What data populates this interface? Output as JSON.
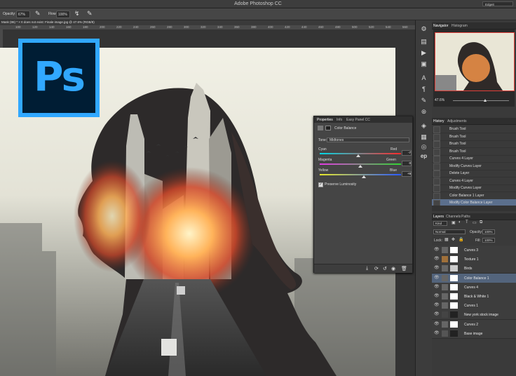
{
  "app": {
    "title": "Adobe Photoshop CC",
    "workspace": "Edgeit"
  },
  "options_bar": {
    "opacity_label": "Opacity:",
    "opacity_value": "67%",
    "flow_label": "Flow:",
    "flow_value": "100%"
  },
  "document_tab": {
    "title": "Mask (86) * ×   It does not exist: Finale image.jpg @ 47.6% (RGB/8)"
  },
  "ruler": {
    "ticks": [
      "100",
      "120",
      "140",
      "160",
      "180",
      "200",
      "220",
      "240",
      "260",
      "280",
      "300",
      "320",
      "340",
      "360",
      "380",
      "400",
      "420",
      "440",
      "460",
      "480",
      "500",
      "520",
      "540",
      "560"
    ]
  },
  "logo": {
    "text": "Ps"
  },
  "navigator": {
    "tabs": [
      "Navigator",
      "Histogram"
    ],
    "zoom": "47.6%"
  },
  "history": {
    "tabs": [
      "History",
      "Adjustments"
    ],
    "items": [
      {
        "label": "Brush Tool"
      },
      {
        "label": "Brush Tool"
      },
      {
        "label": "Brush Tool"
      },
      {
        "label": "Brush Tool"
      },
      {
        "label": "Curves 4 Layer"
      },
      {
        "label": "Modify Curves Layer"
      },
      {
        "label": "Delete Layer"
      },
      {
        "label": "Curves 4 Layer"
      },
      {
        "label": "Modify Curves Layer"
      },
      {
        "label": "Color Balance 1 Layer"
      },
      {
        "label": "Modify Color Balance Layer"
      }
    ]
  },
  "layers": {
    "tabs": [
      "Layers",
      "Channels",
      "Paths"
    ],
    "kind_label": "Kind",
    "blend_mode": "Normal",
    "opacity_label": "Opacity:",
    "opacity_value": "100%",
    "lock_label": "Lock:",
    "fill_label": "Fill:",
    "fill_value": "100%",
    "items": [
      {
        "label": "Curves 3"
      },
      {
        "label": "Texture 1"
      },
      {
        "label": "Birds"
      },
      {
        "label": "Color Balance 1"
      },
      {
        "label": "Curves 4"
      },
      {
        "label": "Black & White 1"
      },
      {
        "label": "Curves 1"
      },
      {
        "label": "New york stock image"
      },
      {
        "label": "Curves 2"
      },
      {
        "label": "Base image"
      }
    ]
  },
  "properties": {
    "tabs": [
      "Properties",
      "Info",
      "Easy Panel CC"
    ],
    "title": "Color Balance",
    "tone_label": "Tone:",
    "tone_value": "Midtones",
    "sliders": [
      {
        "left": "Cyan",
        "right": "Red",
        "value": "-7",
        "position": 0.47
      },
      {
        "left": "Magenta",
        "right": "Green",
        "value": "0",
        "position": 0.5
      },
      {
        "left": "Yellow",
        "right": "Blue",
        "value": "+9",
        "position": 0.54
      }
    ],
    "preserve_label": "Preserve Luminosity"
  }
}
